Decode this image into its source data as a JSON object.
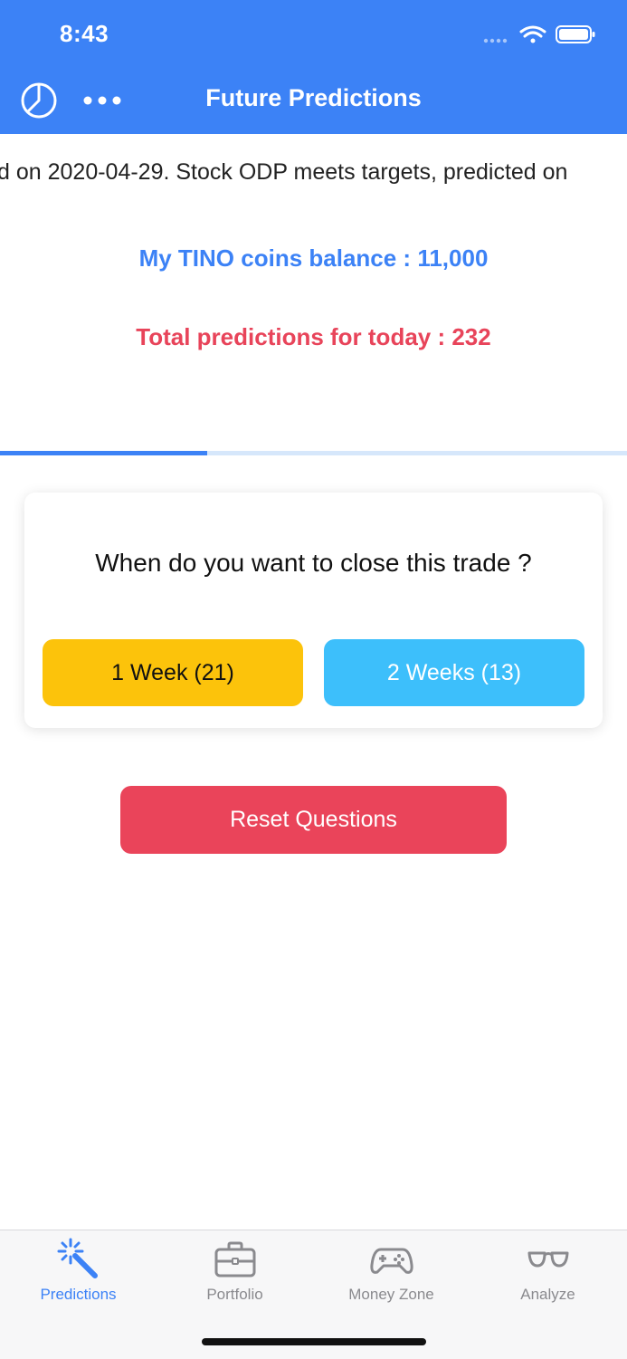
{
  "status_bar": {
    "time": "8:43"
  },
  "nav": {
    "title": "Future Predictions",
    "left_icon": "pie-chart-icon",
    "more_icon": "ellipsis-icon"
  },
  "ticker": {
    "text": "d on 2020-04-29. Stock ODP meets targets, predicted on"
  },
  "balance_text": "My TINO coins balance : 11,000",
  "total_text": "Total predictions for today : 232",
  "progress": {
    "fraction": 0.33
  },
  "question": {
    "text": "When do you want to close this trade ?",
    "options": [
      {
        "label": "1 Week (21)"
      },
      {
        "label": "2 Weeks (13)"
      }
    ]
  },
  "reset_label": "Reset Questions",
  "tabs": [
    {
      "label": "Predictions",
      "icon": "magic-wand-icon",
      "active": true
    },
    {
      "label": "Portfolio",
      "icon": "briefcase-icon",
      "active": false
    },
    {
      "label": "Money Zone",
      "icon": "gamepad-icon",
      "active": false
    },
    {
      "label": "Analyze",
      "icon": "glasses-icon",
      "active": false
    }
  ],
  "colors": {
    "primary": "#3c82f6",
    "danger": "#ea445a",
    "option1": "#fcc30b",
    "option2": "#3dbffb",
    "tab_inactive": "#8a8a8e"
  }
}
